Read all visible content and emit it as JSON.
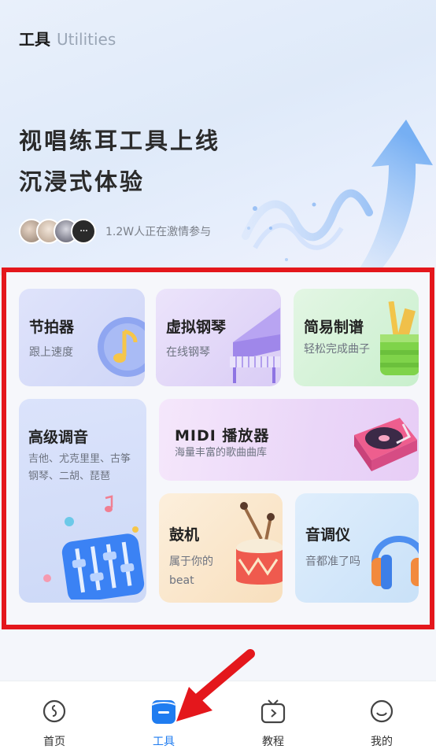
{
  "header": {
    "title_cn": "工具",
    "title_en": "Utilities"
  },
  "banner": {
    "headline_line1": "视唱练耳工具上线",
    "headline_line2": "沉浸式体验",
    "participants_text": "1.2W人正在激情参与",
    "more_glyph": "···"
  },
  "tools": {
    "metronome": {
      "title": "节拍器",
      "subtitle": "跟上速度",
      "icon": "music-note-icon"
    },
    "virtual_piano": {
      "title": "虚拟钢琴",
      "subtitle": "在线钢琴",
      "icon": "piano-icon"
    },
    "simple_score": {
      "title": "简易制谱",
      "subtitle": "轻松完成曲子",
      "icon": "pencil-cup-icon"
    },
    "advanced_tuner": {
      "title": "高级调音",
      "subtitle_line1": "吉他、尤克里里、古筝",
      "subtitle_line2": "钢琴、二胡、琵琶",
      "icon": "mixer-sliders-icon"
    },
    "midi_player": {
      "title": "MIDI 播放器",
      "subtitle": "海量丰富的歌曲曲库",
      "icon": "turntable-icon"
    },
    "drum_machine": {
      "title": "鼓机",
      "subtitle_line1": "属于你的",
      "subtitle_line2": "beat",
      "icon": "drum-icon"
    },
    "pitch_meter": {
      "title": "音调仪",
      "subtitle": "音都准了吗",
      "icon": "headphones-icon"
    }
  },
  "tabbar": {
    "items": [
      {
        "label": "首页",
        "icon": "home-music-icon",
        "active": false
      },
      {
        "label": "工具",
        "icon": "tools-icon",
        "active": true
      },
      {
        "label": "教程",
        "icon": "tv-play-icon",
        "active": false
      },
      {
        "label": "我的",
        "icon": "smile-icon",
        "active": false
      }
    ]
  },
  "colors": {
    "accent": "#1f7cf0",
    "highlight_frame": "#e4171c",
    "arrow": "#e4171c"
  }
}
